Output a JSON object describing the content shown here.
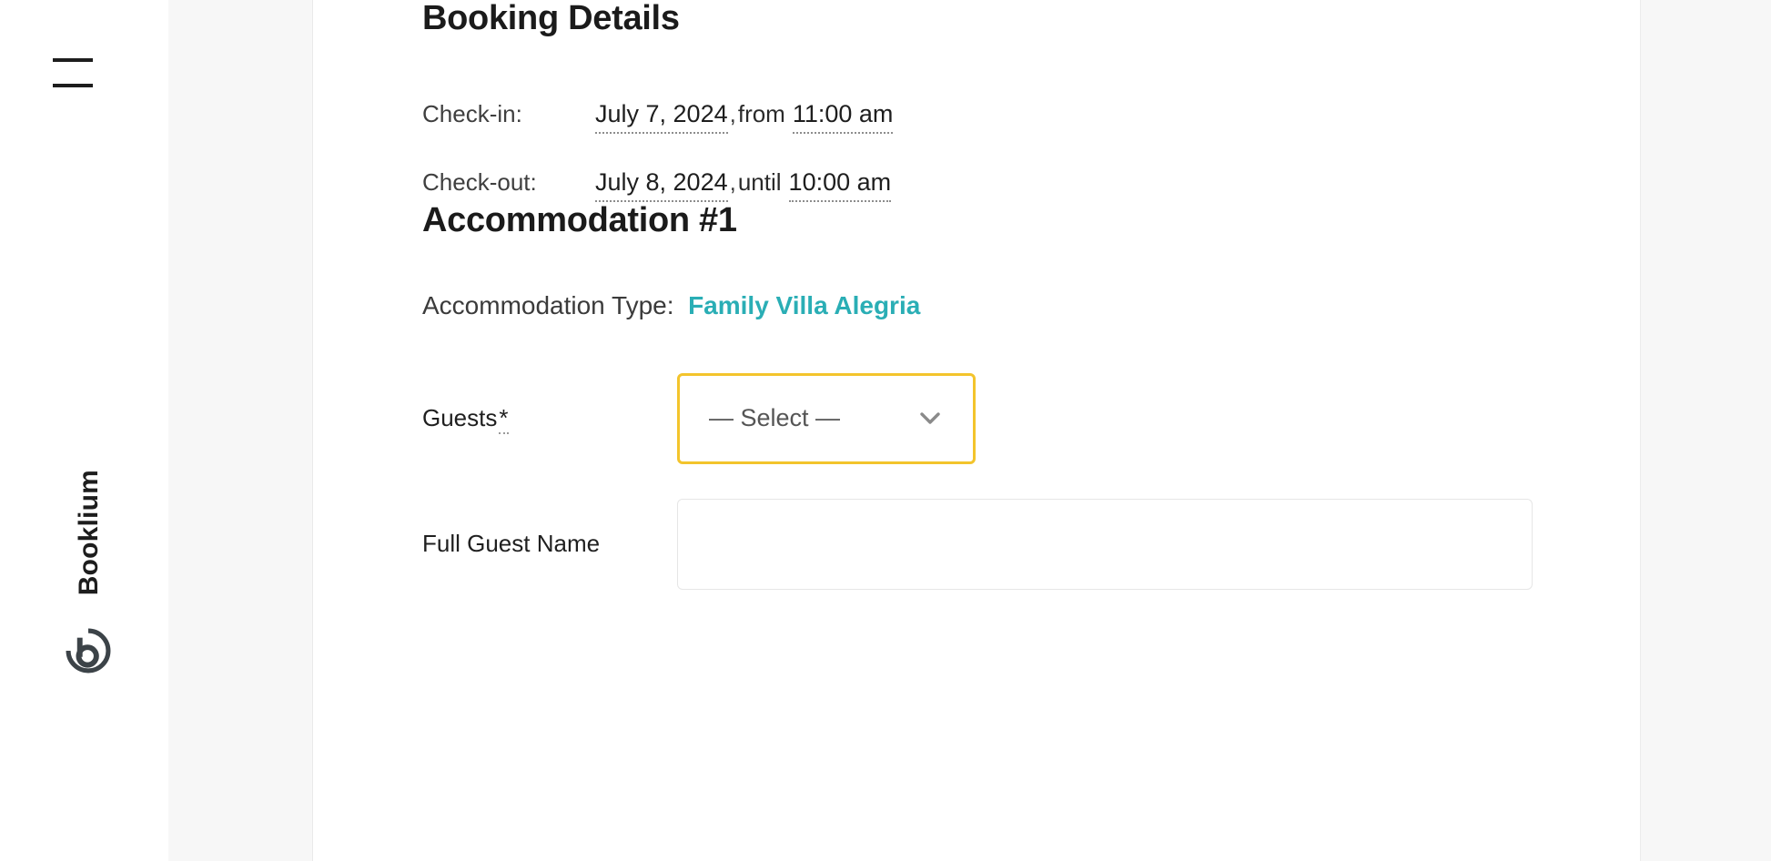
{
  "brand": {
    "wordmark": "Booklium",
    "logo_icon": "booklium-circle-b-mark",
    "menu_icon": "hamburger-menu-icon"
  },
  "theme": {
    "accent_teal": "#2aaeb5",
    "focus_yellow": "#f3c42c",
    "text_primary": "#1b1b1b",
    "text_secondary": "#3b3b3b",
    "gutter_gray": "#f7f7f7",
    "input_border": "#e6e6e6"
  },
  "main": {
    "booking_details": {
      "heading": "Booking Details",
      "rows": [
        {
          "label": "Check-in:",
          "date": "July 7, 2024",
          "comma": ",",
          "conjunction": "from",
          "time": "11:00 am"
        },
        {
          "label": "Check-out:",
          "date": "July 8, 2024",
          "comma": ",",
          "conjunction": "until",
          "time": "10:00 am"
        }
      ]
    },
    "accommodation": {
      "heading": "Accommodation #1",
      "type_label": "Accommodation Type:",
      "type_value": "Family Villa Alegria",
      "fields": {
        "guests": {
          "label": "Guests",
          "required_marker": "*",
          "selected_option": "— Select —",
          "dropdown_icon": "chevron-down-icon"
        },
        "full_guest_name": {
          "label": "Full Guest Name",
          "value": "",
          "placeholder": ""
        }
      }
    }
  }
}
